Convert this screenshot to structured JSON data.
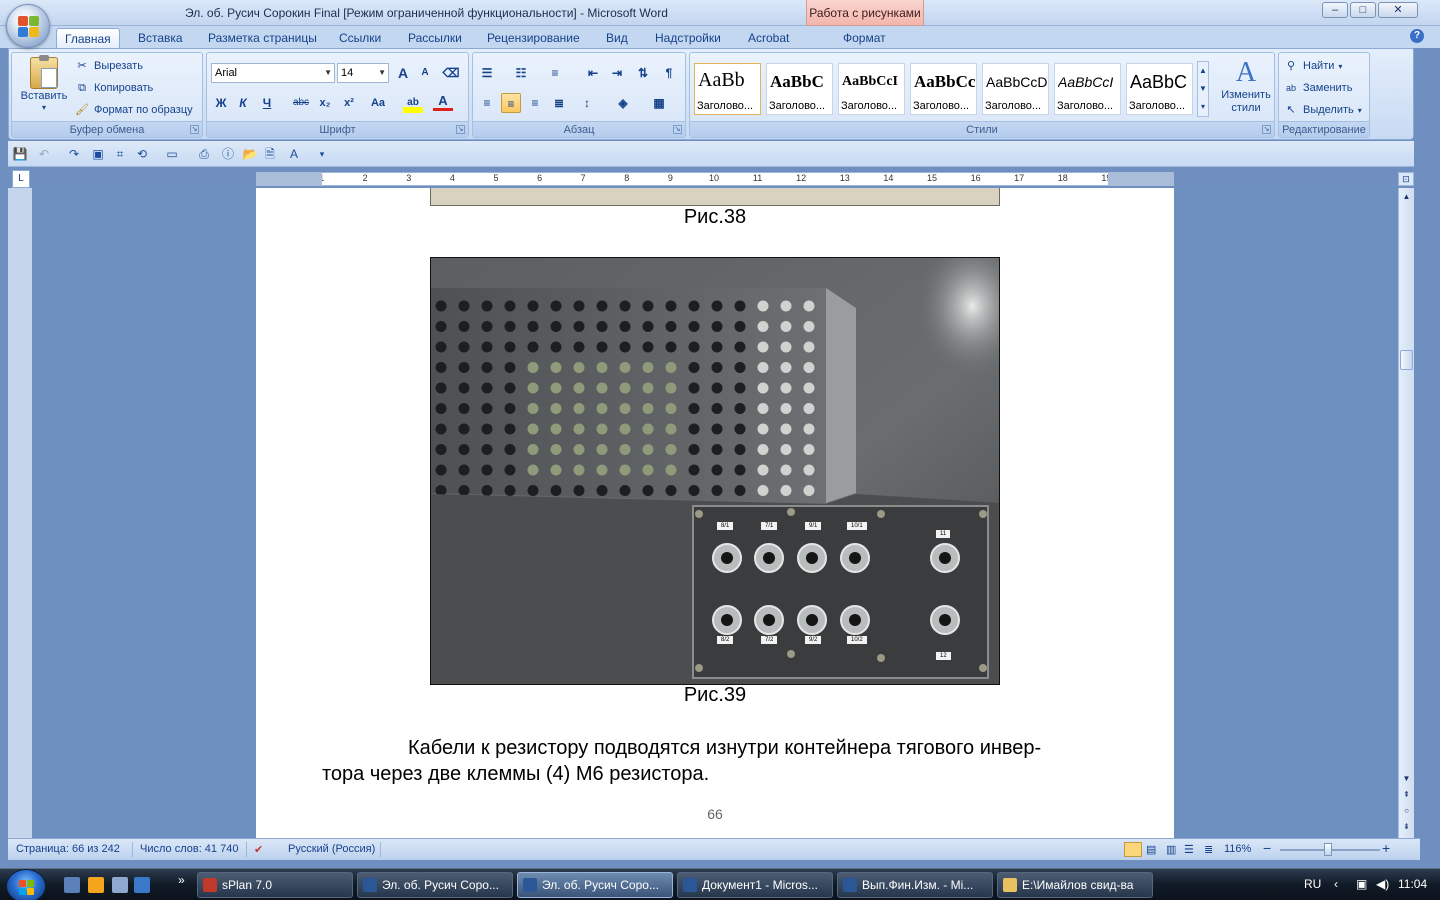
{
  "window": {
    "title": "Эл. об. Русич Сорокин Final [Режим ограниченной функциональности] - Microsoft Word",
    "context_tab_title": "Работа с рисунками",
    "controls": {
      "minimize": "–",
      "maximize": "□",
      "close": "✕"
    }
  },
  "tabs": [
    {
      "label": "Главная",
      "active": true
    },
    {
      "label": "Вставка"
    },
    {
      "label": "Разметка страницы"
    },
    {
      "label": "Ссылки"
    },
    {
      "label": "Рассылки"
    },
    {
      "label": "Рецензирование"
    },
    {
      "label": "Вид"
    },
    {
      "label": "Надстройки"
    },
    {
      "label": "Acrobat"
    },
    {
      "label": "Формат"
    }
  ],
  "help_glyph": "?",
  "ribbon": {
    "clipboard": {
      "paste": "Вставить",
      "cut": "Вырезать",
      "copy": "Копировать",
      "format_painter": "Формат по образцу",
      "label": "Буфер обмена"
    },
    "font": {
      "family": "Arial",
      "size": "14",
      "grow": "A",
      "shrink": "A",
      "bold": "Ж",
      "italic": "К",
      "underline": "Ч",
      "strike": "abc",
      "subscript": "x₂",
      "superscript": "x²",
      "case": "Aa",
      "highlight": "ab",
      "color": "A",
      "label": "Шрифт"
    },
    "paragraph": {
      "label": "Абзац",
      "show_marks": "¶"
    },
    "styles": {
      "items": [
        {
          "sample": "AaBb",
          "name": "Заголово..."
        },
        {
          "sample": "AaBbC",
          "name": "Заголово..."
        },
        {
          "sample": "AaBbCcI",
          "name": "Заголово..."
        },
        {
          "sample": "AaBbCc",
          "name": "Заголово..."
        },
        {
          "sample": "AaBbCcD",
          "name": "Заголово..."
        },
        {
          "sample": "AaBbCcI",
          "name": "Заголово..."
        },
        {
          "sample": "AaBbC",
          "name": "Заголово..."
        }
      ],
      "change_styles_line1": "Изменить",
      "change_styles_line2": "стили",
      "label": "Стили"
    },
    "editing": {
      "find": "Найти",
      "replace": "Заменить",
      "select": "Выделить",
      "label": "Редактирование"
    }
  },
  "ruler": {
    "corner": "L",
    "numbers": [
      "1",
      "1",
      "2",
      "3",
      "4",
      "5",
      "6",
      "7",
      "8",
      "9",
      "10",
      "11",
      "12",
      "13",
      "14",
      "15",
      "16",
      "17",
      "18",
      "19"
    ]
  },
  "document": {
    "caption_prev": "Рис.38",
    "caption": "Рис.39",
    "paragraph_line1": "Кабели к резистору подводятся изнутри контейнера тягового инвер-",
    "paragraph_line2": "тора через две клеммы (4) М6 резистора.",
    "page_number": "66",
    "photo_labels_top": [
      "8/1",
      "7/1",
      "9/1",
      "10/1",
      "11"
    ],
    "photo_labels_bottom": [
      "8/2",
      "7/2",
      "9/2",
      "10/2",
      "12"
    ]
  },
  "statusbar": {
    "page": "Страница: 66 из 242",
    "words": "Число слов: 41 740",
    "language": "Русский (Россия)",
    "zoom": "116%",
    "zoom_minus": "−",
    "zoom_plus": "+"
  },
  "taskbar": {
    "tasks": [
      {
        "label": "sPlan 7.0"
      },
      {
        "label": "Эл. об. Русич Соро..."
      },
      {
        "label": "Эл. об. Русич Соро...",
        "active": true
      },
      {
        "label": "Документ1 - Micros..."
      },
      {
        "label": "Вып.Фин.Изм. - Mi..."
      },
      {
        "label": "E:\\Имайлов свид-ва"
      }
    ],
    "more": "»",
    "lang": "RU",
    "clock": "11:04"
  },
  "colors": {
    "ribbon_bg": "#d0e0f5",
    "doc_bg": "#6e90c1",
    "context_tab": "#f4b5ab",
    "taskbar": "#111b27"
  }
}
